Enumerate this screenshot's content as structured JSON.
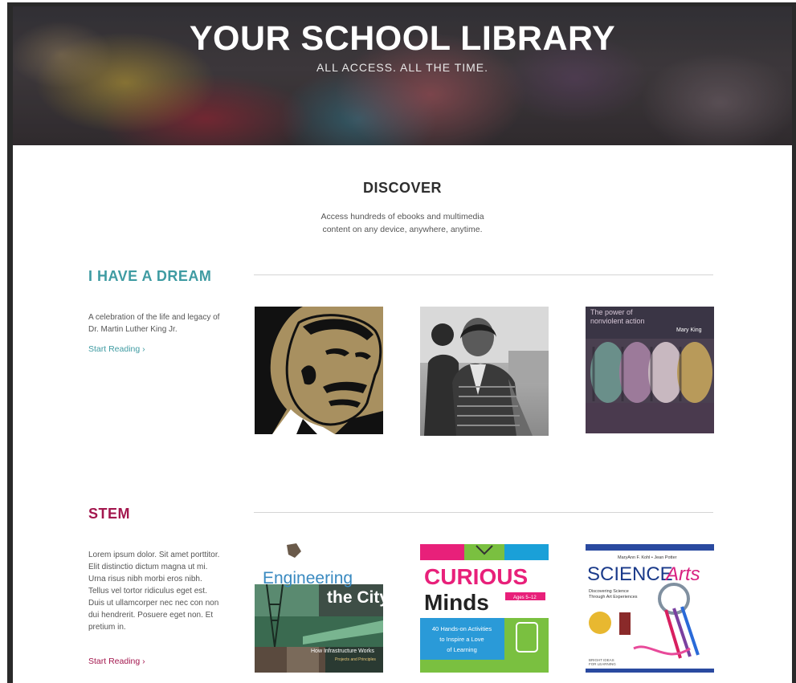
{
  "hero": {
    "title": "YOUR SCHOOL LIBRARY",
    "subtitle": "ALL ACCESS. ALL THE TIME."
  },
  "discover": {
    "title": "DISCOVER",
    "description_line1": "Access hundreds of ebooks and multimedia",
    "description_line2": "content on any device, anywhere, anytime."
  },
  "sections": [
    {
      "title": "I HAVE A DREAM",
      "description": "A celebration of the life and legacy of Dr. Martin Luther King Jr.",
      "link": "Start Reading ›",
      "accent": "#3f9ba2",
      "books": [
        {
          "title": "Martin Luther King Jr. illustration"
        },
        {
          "title": "Rosa Parks photograph"
        },
        {
          "cover_text_1": "The power of",
          "cover_text_2": "nonviolent action",
          "author": "Mary King"
        }
      ]
    },
    {
      "title": "STEM",
      "description": "Lorem ipsum dolor. Sit amet porttitor. Elit distinctio dictum magna ut mi. Urna risus nibh morbi eros nibh. Tellus vel tortor ridiculus eget est. Duis ut ullamcorper nec nec con non dui hendrerit. Posuere eget non. Et pretium in.",
      "link": "Start Reading ›",
      "accent": "#a3174e",
      "books": [
        {
          "title_1": "Engineering",
          "title_2": "the City",
          "subtitle": "How Infrastructure Works",
          "sub2": "Projects and Principles"
        },
        {
          "title_1": "CURIOUS",
          "title_2": "Minds",
          "ages": "Ages 5–12",
          "tagline_1": "40 Hands-on Activities",
          "tagline_2": "to Inspire a Love",
          "tagline_3": "of Learning"
        },
        {
          "authors": "MaryAnn F. Kohl • Jean Potter",
          "title_1": "SCIENCE",
          "title_2": "Arts",
          "subtitle_1": "Discovering Science",
          "subtitle_2": "Through Art Experiences",
          "series_1": "BRIGHT IDEAS",
          "series_2": "FOR LEARNING"
        }
      ]
    }
  ],
  "colors": {
    "teal": "#3f9ba2",
    "magenta": "#a3174e",
    "frame": "#2a2a2a"
  }
}
